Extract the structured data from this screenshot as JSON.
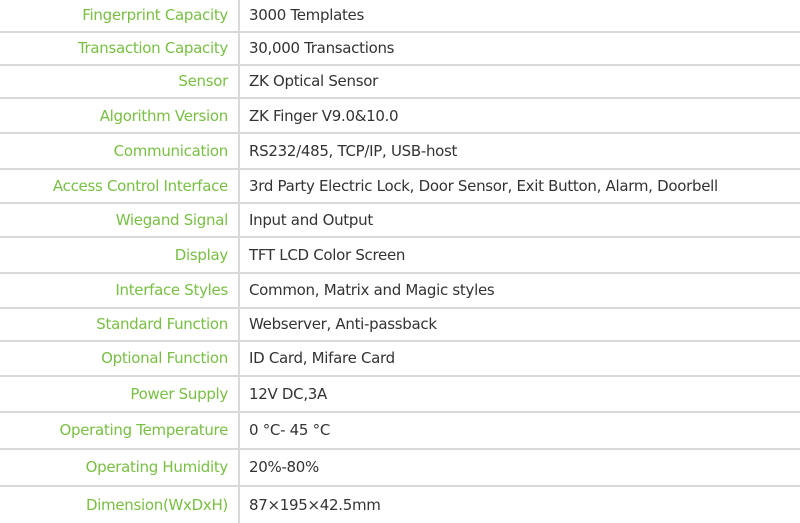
{
  "colors": {
    "label": "#78bf43",
    "value": "#333333",
    "divider": "#d9d9d9"
  },
  "specs": [
    {
      "label": "Fingerprint Capacity",
      "value": "3000 Templates"
    },
    {
      "label": "Transaction Capacity",
      "value": "30,000 Transactions"
    },
    {
      "label": "Sensor",
      "value": "ZK Optical Sensor"
    },
    {
      "label": "Algorithm Version",
      "value": "ZK Finger V9.0&10.0"
    },
    {
      "label": "Communication",
      "value": "RS232/485, TCP/IP, USB-host"
    },
    {
      "label": "Access Control Interface",
      "value": "3rd Party Electric Lock, Door Sensor, Exit Button, Alarm, Doorbell"
    },
    {
      "label": "Wiegand Signal",
      "value": "Input and Output"
    },
    {
      "label": "Display",
      "value": "TFT LCD Color Screen"
    },
    {
      "label": "Interface Styles",
      "value": "Common, Matrix and Magic styles"
    },
    {
      "label": "Standard Function",
      "value": "Webserver, Anti-passback"
    },
    {
      "label": "Optional Function",
      "value": "ID Card, Mifare Card"
    },
    {
      "label": "Power Supply",
      "value": "12V DC,3A"
    },
    {
      "label": "Operating Temperature",
      "value": "0 °C- 45 °C"
    },
    {
      "label": "Operating Humidity",
      "value": "20%-80%"
    },
    {
      "label": "Dimension(WxDxH)",
      "value": "87×195×42.5mm"
    }
  ]
}
